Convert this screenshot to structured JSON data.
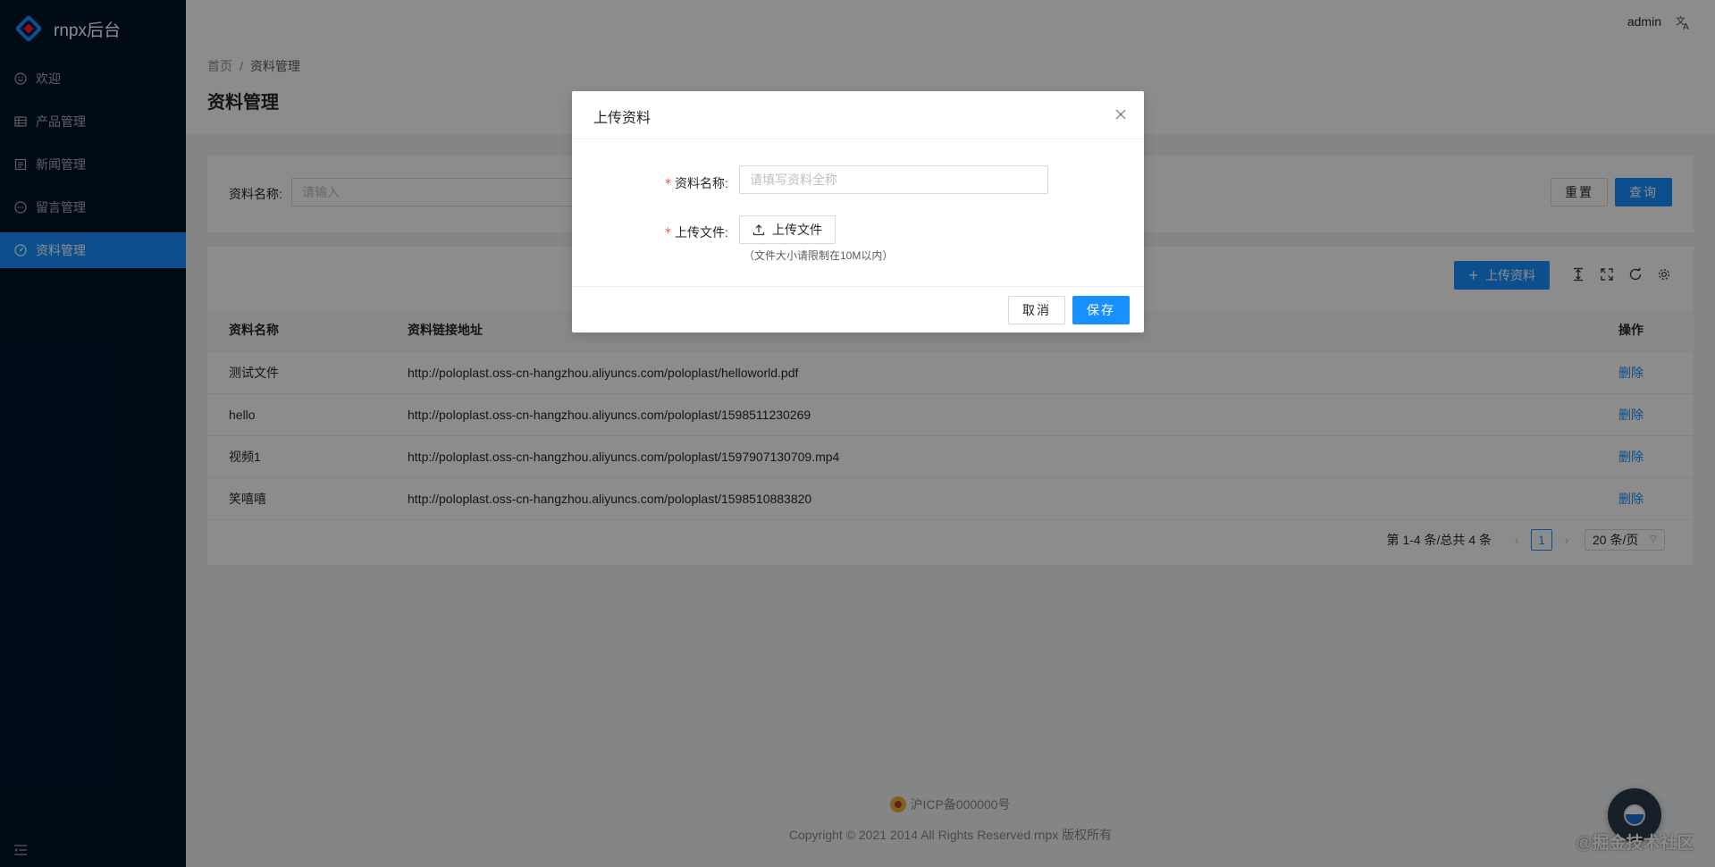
{
  "app": {
    "title": "rnpx后台"
  },
  "sidebar": {
    "items": [
      {
        "label": "欢迎",
        "icon": "smile-icon"
      },
      {
        "label": "产品管理",
        "icon": "table-icon"
      },
      {
        "label": "新闻管理",
        "icon": "profile-icon"
      },
      {
        "label": "留言管理",
        "icon": "message-icon"
      },
      {
        "label": "资料管理",
        "icon": "dashboard-icon",
        "active": true
      }
    ]
  },
  "header": {
    "user": "admin",
    "lang_icon": "translation-icon"
  },
  "breadcrumb": {
    "home": "首页",
    "separator": "/",
    "current": "资料管理"
  },
  "page": {
    "title": "资料管理"
  },
  "search": {
    "label": "资料名称:",
    "placeholder": "请输入",
    "reset_label": "重置",
    "query_label": "查询"
  },
  "toolbar": {
    "upload_label": "上传资料"
  },
  "table": {
    "columns": {
      "name": "资料名称",
      "url": "资料链接地址",
      "op": "操作"
    },
    "rows": [
      {
        "name": "测试文件",
        "url": "http://poloplast.oss-cn-hangzhou.aliyuncs.com/poloplast/helloworld.pdf",
        "op": "删除"
      },
      {
        "name": "hello",
        "url": "http://poloplast.oss-cn-hangzhou.aliyuncs.com/poloplast/1598511230269",
        "op": "删除"
      },
      {
        "name": "视频1",
        "url": "http://poloplast.oss-cn-hangzhou.aliyuncs.com/poloplast/1597907130709.mp4",
        "op": "删除"
      },
      {
        "name": "笑嘻嘻",
        "url": "http://poloplast.oss-cn-hangzhou.aliyuncs.com/poloplast/1598510883820",
        "op": "删除"
      }
    ]
  },
  "pagination": {
    "total_text": "第 1-4 条/总共 4 条",
    "current_page": "1",
    "page_size": "20 条/页"
  },
  "footer": {
    "icp": "沪ICP备000000号",
    "copyright": "Copyright © 2021 2014 All Rights Reserved rnpx 版权所有"
  },
  "watermark": "@掘金技术社区",
  "modal": {
    "title": "上传资料",
    "name_label": "资料名称",
    "name_placeholder": "请填写资料全称",
    "file_label": "上传文件",
    "upload_button": "上传文件",
    "hint": "（文件大小请限制在10M以内）",
    "cancel_label": "取消",
    "save_label": "保存"
  },
  "colors": {
    "primary": "#1890ff",
    "sider": "#001529",
    "danger": "#ff4d4f"
  }
}
